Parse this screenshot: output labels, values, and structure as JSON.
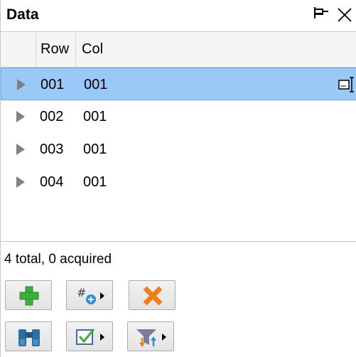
{
  "panel": {
    "title": "Data"
  },
  "grid": {
    "columns": [
      "Row",
      "Col"
    ],
    "rows": [
      {
        "row": "001",
        "col": "001",
        "selected": true
      },
      {
        "row": "002",
        "col": "001",
        "selected": false
      },
      {
        "row": "003",
        "col": "001",
        "selected": false
      },
      {
        "row": "004",
        "col": "001",
        "selected": false
      }
    ]
  },
  "status": {
    "text": "4 total, 0 acquired"
  },
  "toolbar": {
    "buttons": [
      {
        "name": "add-button",
        "icon": "plus-icon"
      },
      {
        "name": "add-numbered-dropdown-button",
        "icon": "hash-plus-icon"
      },
      {
        "name": "delete-button",
        "icon": "x-icon"
      },
      {
        "name": "find-button",
        "icon": "binoculars-icon"
      },
      {
        "name": "check-dropdown-button",
        "icon": "checkbox-icon"
      },
      {
        "name": "filter-sort-dropdown-button",
        "icon": "filter-sort-icon"
      }
    ]
  },
  "colors": {
    "selection": "#98c9f7",
    "selection_border": "#5fa8ee",
    "add_green": "#3cae3c",
    "delete_orange": "#f07f1a"
  }
}
